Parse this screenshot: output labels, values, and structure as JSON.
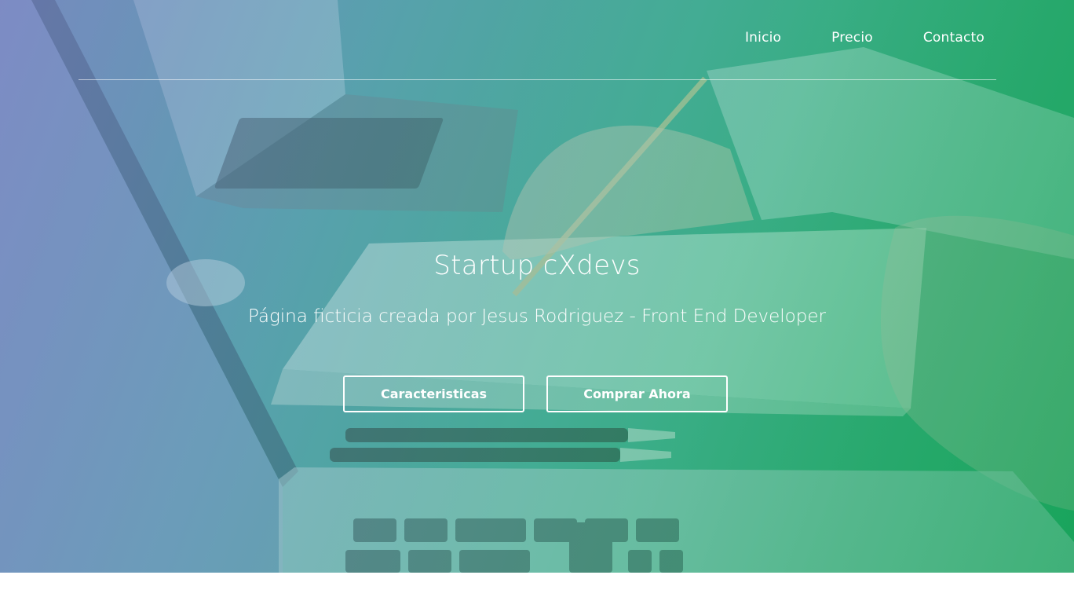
{
  "nav": {
    "items": [
      {
        "label": "Inicio"
      },
      {
        "label": "Precio"
      },
      {
        "label": "Contacto"
      }
    ]
  },
  "hero": {
    "title": "Startup cXdevs",
    "subtitle": "Página ficticia creada por Jesus Rodriguez - Front End Developer",
    "buttons": {
      "features_label": "Caracteristicas",
      "buy_label": "Comprar Ahora"
    }
  },
  "colors": {
    "gradient_start": "#7a86c4",
    "gradient_end": "#0fa24f",
    "text": "#ffffff"
  }
}
